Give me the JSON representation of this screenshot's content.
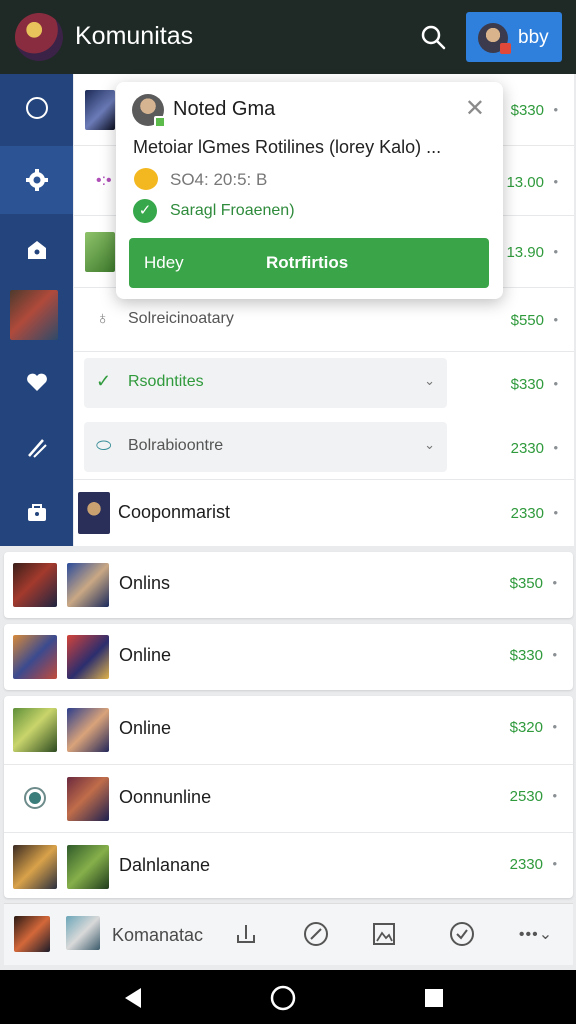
{
  "app": {
    "title": "Komunitas",
    "user_label": "bby"
  },
  "sidebar": {
    "items": [
      "compass",
      "gear",
      "shop",
      "heart",
      "pencil",
      "bag"
    ]
  },
  "popup": {
    "title": "Noted Gma",
    "description": "Metoiar lGmes Rotilines (lorey Kalo) ...",
    "time": "SO4: 20:5: B",
    "status": "Saragl Froaenen)",
    "action_left": "Hdey",
    "action_main": "Rotrfirtios"
  },
  "list": {
    "rows": [
      {
        "label": "",
        "price": "$330"
      },
      {
        "label": "",
        "price": "13.00"
      },
      {
        "label": "",
        "price": "13.90"
      },
      {
        "label": "Solreicinoatary",
        "price": "$550"
      },
      {
        "label": "Rsodntites",
        "price": "$330"
      },
      {
        "label": "Bolrabioontre",
        "price": "2330"
      },
      {
        "label": "Cooponmarist",
        "price": "2330"
      }
    ]
  },
  "cards": [
    {
      "label": "Onlins",
      "price": "$350"
    },
    {
      "label": "Online",
      "price": "$330"
    },
    {
      "label": "Online",
      "price": "$320"
    },
    {
      "label": "Oonnunline",
      "price": "2530"
    },
    {
      "label": "Dalnlanane",
      "price": "2330"
    }
  ],
  "bottom_nav": {
    "label": "Komanatac"
  },
  "colors": {
    "accent_green": "#36a74a",
    "sidebar_blue": "#23447c",
    "topbar": "#1f2a26",
    "user_button": "#2f7fdc"
  }
}
